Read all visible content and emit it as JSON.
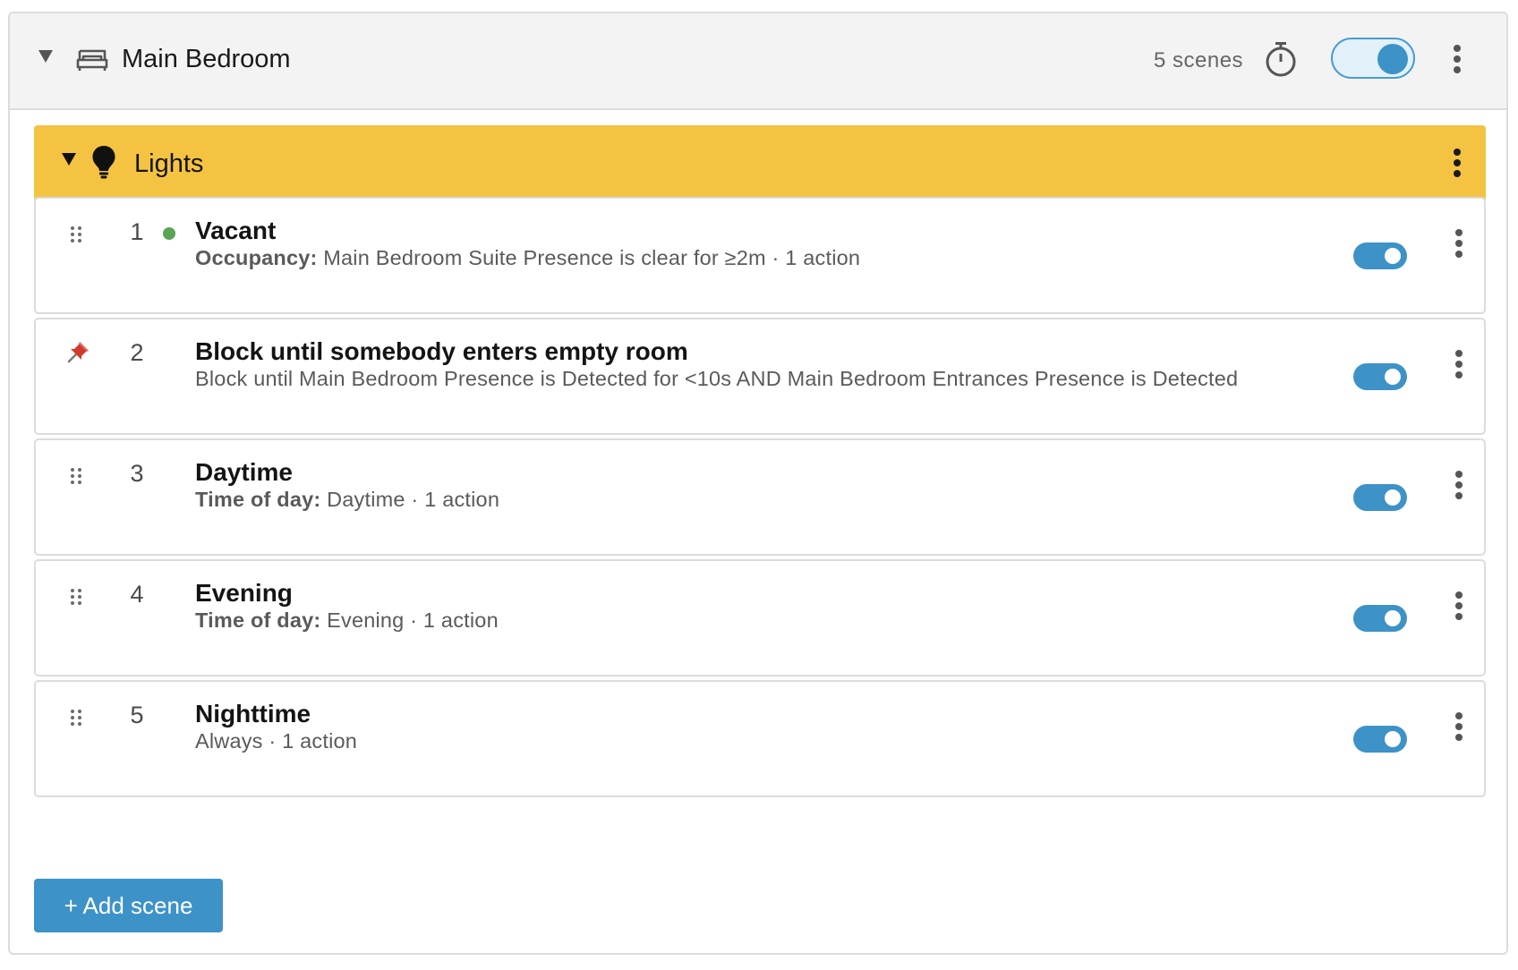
{
  "room": {
    "title": "Main Bedroom",
    "scene_count": "5 scenes",
    "enabled": true,
    "icons": {
      "caret": "caret-down-icon",
      "room": "bed-icon",
      "timer": "stopwatch-icon",
      "more": "more-vertical-icon"
    }
  },
  "group": {
    "title": "Lights",
    "color": "#f5c342",
    "icons": {
      "caret": "caret-down-icon",
      "group": "lightbulb-icon",
      "more": "more-vertical-icon"
    }
  },
  "scenes": [
    {
      "index": "1",
      "name": "Vacant",
      "desc_label": "Occupancy:",
      "desc_text": " Main Bedroom Suite Presence is clear for ≥2m · 1 action",
      "active": true,
      "pinned": false,
      "enabled": true
    },
    {
      "index": "2",
      "name": "Block until somebody enters empty room",
      "desc_label": "",
      "desc_text": "Block until Main Bedroom Presence is Detected for <10s AND Main Bedroom Entrances Presence is Detected",
      "active": false,
      "pinned": true,
      "enabled": true
    },
    {
      "index": "3",
      "name": "Daytime",
      "desc_label": "Time of day:",
      "desc_text": " Daytime · 1 action",
      "active": false,
      "pinned": false,
      "enabled": true
    },
    {
      "index": "4",
      "name": "Evening",
      "desc_label": "Time of day:",
      "desc_text": " Evening · 1 action",
      "active": false,
      "pinned": false,
      "enabled": true
    },
    {
      "index": "5",
      "name": "Nighttime",
      "desc_label": "",
      "desc_text": "Always · 1 action",
      "active": false,
      "pinned": false,
      "enabled": true
    }
  ],
  "add_scene_label": "+ Add scene",
  "colors": {
    "accent": "#3d92c7",
    "active_dot": "#5aa455",
    "pin": "#d0392b"
  }
}
